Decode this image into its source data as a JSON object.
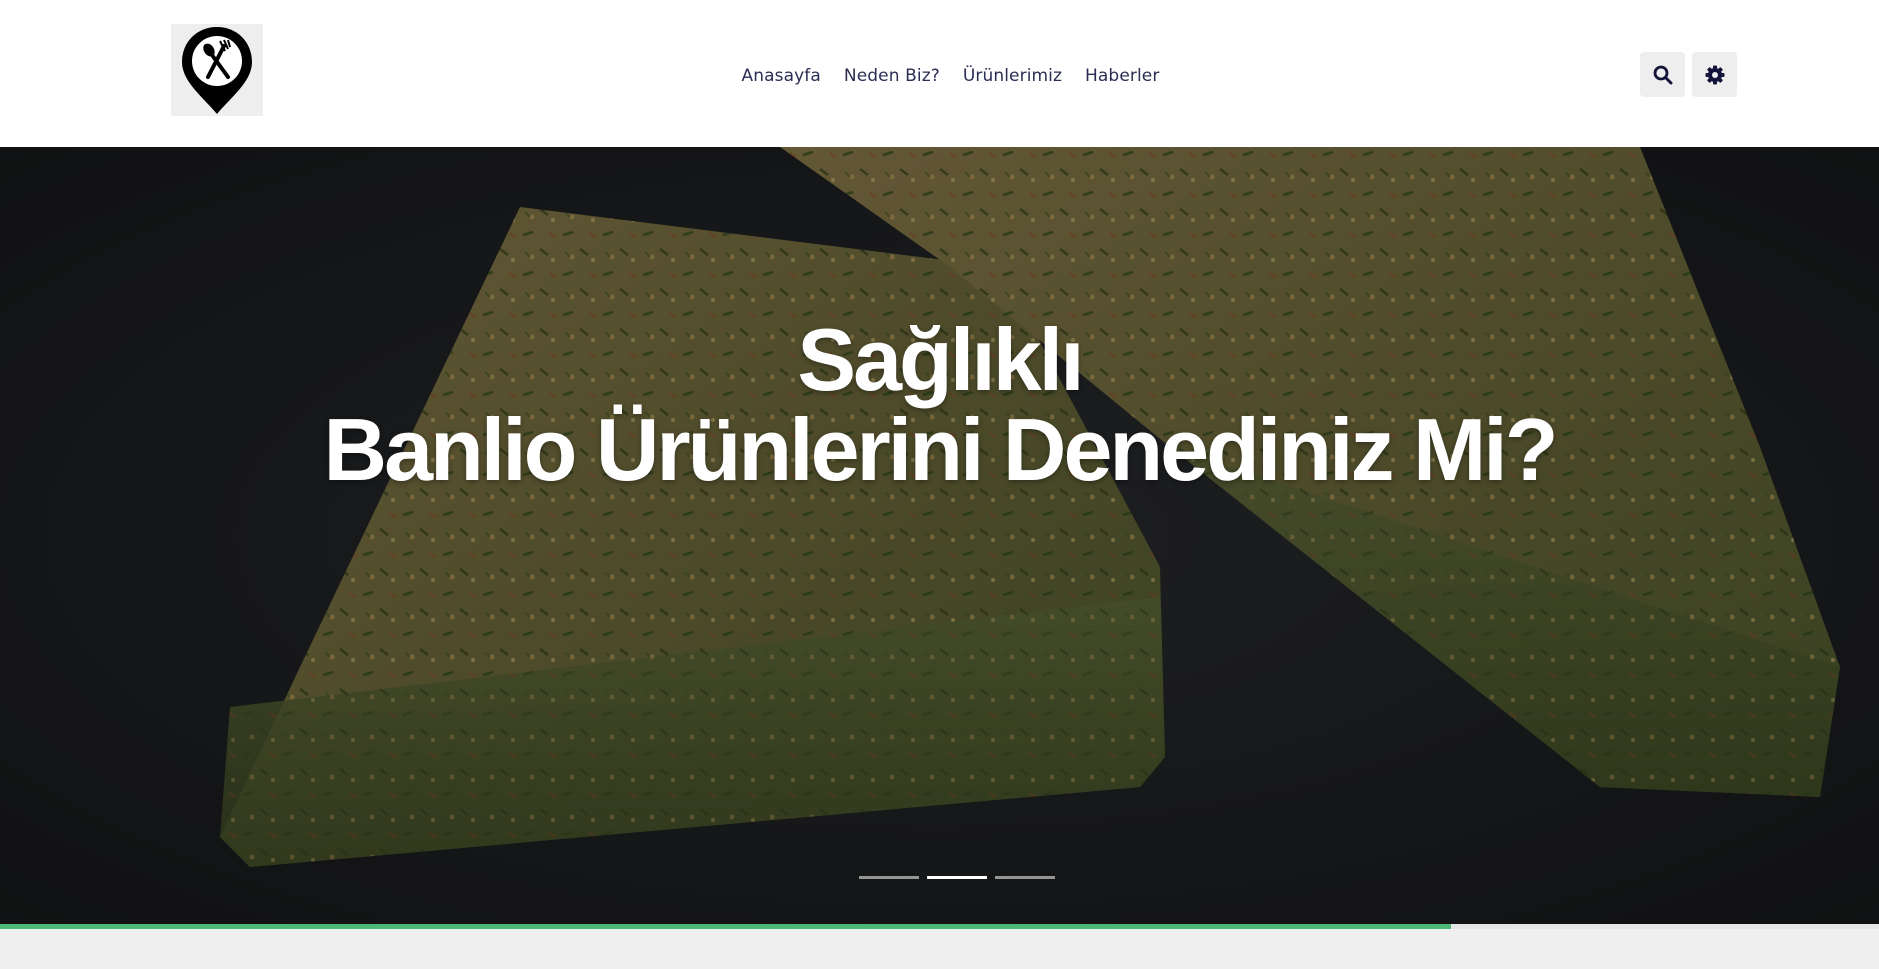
{
  "header": {
    "logo_icon": "map-pin-spoon-fork-icon",
    "nav": [
      {
        "label": "Anasayfa"
      },
      {
        "label": "Neden Biz?"
      },
      {
        "label": "Ürünlerimiz"
      },
      {
        "label": "Haberler"
      }
    ],
    "search_icon": "search-icon",
    "settings_icon": "gear-icon"
  },
  "hero": {
    "title_line1": "Sağlıklı",
    "title_line2": "Banlio Ürünlerini Denediniz Mi?",
    "slides_total": 3,
    "active_slide": 2,
    "slide_progress": 0.772
  },
  "colors": {
    "nav_text": "#2b2d52",
    "progress": "#4bb878",
    "hero_bg": "#1f2124"
  }
}
